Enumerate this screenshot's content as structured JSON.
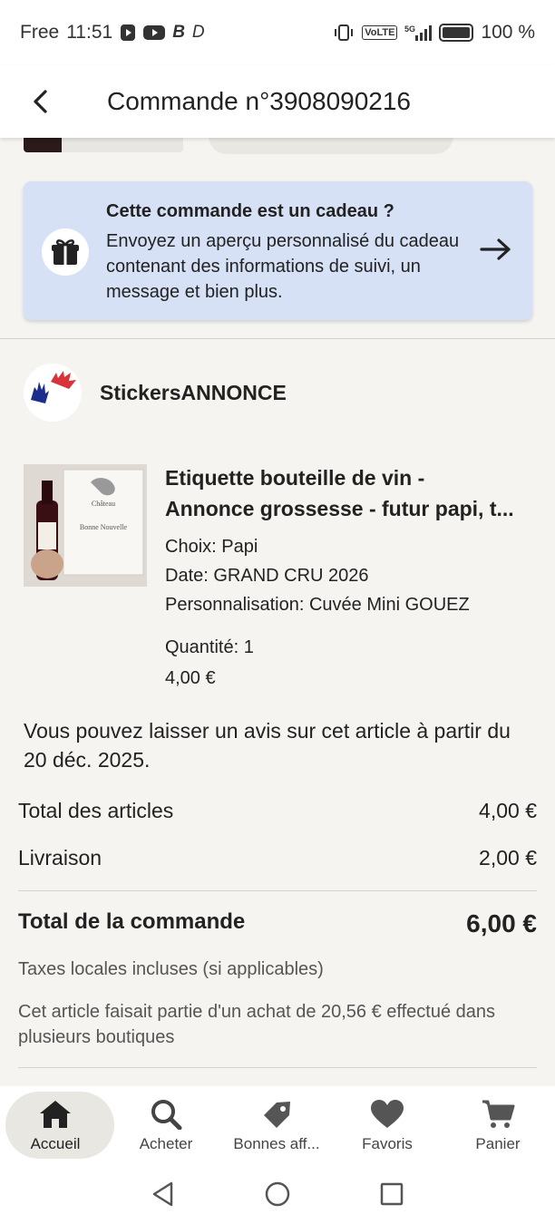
{
  "status_bar": {
    "carrier": "Free",
    "time": "11:51",
    "app_icons": [
      "play-icon",
      "youtube-icon",
      "b-icon",
      "d-icon"
    ],
    "network_label": "VoLTE",
    "network_type": "5G",
    "battery_percent": "100 %",
    "battery_level": 1.0
  },
  "header": {
    "title": "Commande n°3908090216"
  },
  "gift_banner": {
    "title": "Cette commande est un cadeau ?",
    "description": "Envoyez un aperçu personnalisé du cadeau contenant des informations de suivi, un message et bien plus.",
    "background": "#d6e1f6"
  },
  "shop": {
    "name": "StickersANNONCE"
  },
  "item": {
    "title_line1": "Etiquette bouteille de vin -",
    "title_line2": "Annonce grossesse - futur papi, t...",
    "variations": [
      "Choix: Papi",
      "Date: GRAND CRU 2026",
      "Personnalisation: Cuvée Mini GOUEZ"
    ],
    "quantity": "Quantité: 1",
    "price": "4,00 €"
  },
  "review_note": "Vous pouvez laisser un avis sur cet article à partir du 20 déc. 2025.",
  "summary": {
    "items_label": "Total des articles",
    "items_value": "4,00 €",
    "shipping_label": "Livraison",
    "shipping_value": "2,00 €",
    "total_label": "Total de la commande",
    "total_value": "6,00 €",
    "taxes_note": "Taxes locales incluses (si applicables)",
    "multi_shop_note": "Cet article faisait partie d'un achat de 20,56 € effectué dans plusieurs boutiques"
  },
  "bottom_nav": [
    {
      "label": "Accueil",
      "icon": "home-icon",
      "active": true
    },
    {
      "label": "Acheter",
      "icon": "search-icon",
      "active": false
    },
    {
      "label": "Bonnes aff...",
      "icon": "tag-icon",
      "active": false
    },
    {
      "label": "Favoris",
      "icon": "heart-icon",
      "active": false
    },
    {
      "label": "Panier",
      "icon": "cart-icon",
      "active": false
    }
  ],
  "system_nav": [
    "back-triangle-icon",
    "home-circle-icon",
    "recents-square-icon"
  ]
}
